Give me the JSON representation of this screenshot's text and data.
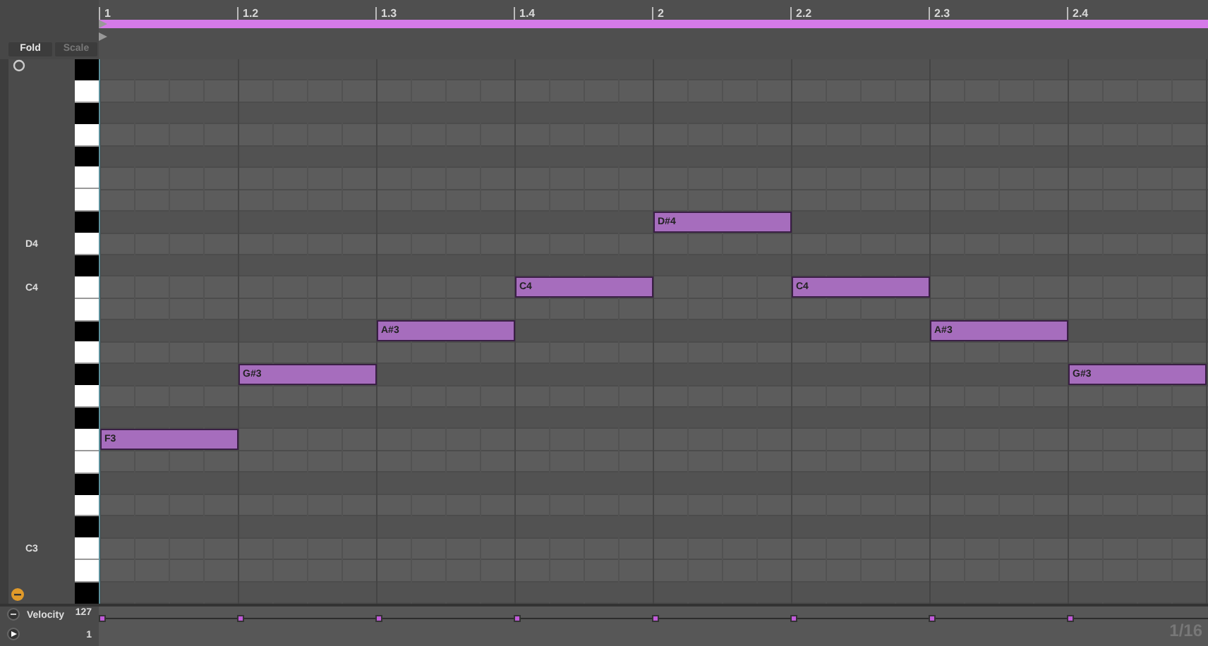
{
  "ruler": [
    {
      "label": "1"
    },
    {
      "label": "1.2"
    },
    {
      "label": "1.3"
    },
    {
      "label": "1.4"
    },
    {
      "label": "2"
    },
    {
      "label": "2.2"
    },
    {
      "label": "2.3"
    },
    {
      "label": "2.4"
    }
  ],
  "buttons": [
    {
      "label": "Fold",
      "disabled": false
    },
    {
      "label": "Scale",
      "disabled": true
    }
  ],
  "keys": [
    {
      "kind": "black"
    },
    {
      "kind": "white"
    },
    {
      "kind": "black"
    },
    {
      "kind": "white"
    },
    {
      "kind": "black"
    },
    {
      "kind": "white"
    },
    {
      "kind": "white"
    },
    {
      "kind": "black",
      "cells": [
        {
          "kind": "empty"
        },
        {
          "kind": "empty"
        },
        {
          "kind": "empty"
        },
        {
          "kind": "empty"
        },
        {
          "kind": "note",
          "label": "D#4"
        },
        {
          "kind": "empty"
        },
        {
          "kind": "empty"
        },
        {
          "kind": "empty"
        }
      ]
    },
    {
      "kind": "white",
      "label": "D4"
    },
    {
      "kind": "black"
    },
    {
      "kind": "white",
      "label": "C4",
      "cells": [
        {
          "kind": "empty"
        },
        {
          "kind": "empty"
        },
        {
          "kind": "empty"
        },
        {
          "kind": "note",
          "label": "C4"
        },
        {
          "kind": "empty"
        },
        {
          "kind": "note",
          "label": "C4"
        },
        {
          "kind": "empty"
        },
        {
          "kind": "empty"
        }
      ]
    },
    {
      "kind": "white"
    },
    {
      "kind": "black",
      "cells": [
        {
          "kind": "empty"
        },
        {
          "kind": "empty"
        },
        {
          "kind": "note",
          "label": "A#3"
        },
        {
          "kind": "empty"
        },
        {
          "kind": "empty"
        },
        {
          "kind": "empty"
        },
        {
          "kind": "note",
          "label": "A#3"
        },
        {
          "kind": "empty"
        }
      ]
    },
    {
      "kind": "white"
    },
    {
      "kind": "black",
      "cells": [
        {
          "kind": "empty"
        },
        {
          "kind": "note",
          "label": "G#3"
        },
        {
          "kind": "empty"
        },
        {
          "kind": "empty"
        },
        {
          "kind": "empty"
        },
        {
          "kind": "empty"
        },
        {
          "kind": "empty"
        },
        {
          "kind": "note",
          "label": "G#3"
        }
      ]
    },
    {
      "kind": "white"
    },
    {
      "kind": "black"
    },
    {
      "kind": "white",
      "cells": [
        {
          "kind": "note",
          "label": "F3"
        },
        {
          "kind": "empty"
        },
        {
          "kind": "empty"
        },
        {
          "kind": "empty"
        },
        {
          "kind": "empty"
        },
        {
          "kind": "empty"
        },
        {
          "kind": "empty"
        },
        {
          "kind": "empty"
        }
      ]
    },
    {
      "kind": "white"
    },
    {
      "kind": "black"
    },
    {
      "kind": "white"
    },
    {
      "kind": "black"
    },
    {
      "kind": "white",
      "label": "C3"
    },
    {
      "kind": "white"
    },
    {
      "kind": "black"
    }
  ],
  "velocity": {
    "label": "Velocity",
    "max": "127",
    "min": "1"
  },
  "grid": "1/16"
}
